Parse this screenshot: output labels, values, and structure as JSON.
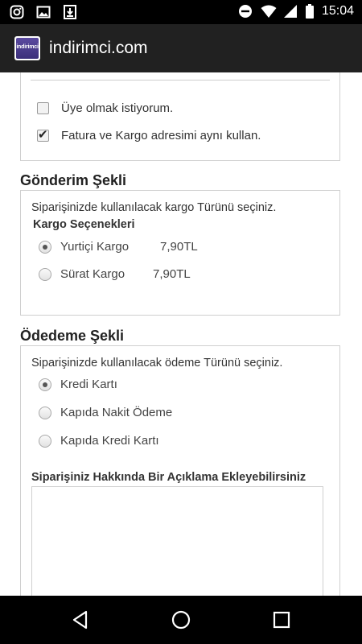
{
  "status_bar": {
    "left_icons": [
      "instagram-icon",
      "image-icon",
      "download-icon"
    ],
    "right_icons": [
      "do-not-disturb-icon",
      "wifi-icon",
      "signal-icon",
      "battery-icon"
    ],
    "time": "15:04"
  },
  "app_bar": {
    "logo_text": "indirimci",
    "title": "indirimci.com"
  },
  "account_options": {
    "items": [
      {
        "label": "Üye olmak istiyorum.",
        "checked": false
      },
      {
        "label": "Fatura ve Kargo adresimi aynı kullan.",
        "checked": true
      }
    ]
  },
  "shipping": {
    "title": "Gönderim Şekli",
    "hint": "Siparişinizde kullanılacak kargo Türünü seçiniz.",
    "subheading": "Kargo Seçenekleri",
    "options": [
      {
        "label": "Yurtiçi Kargo",
        "price": "7,90TL",
        "selected": true
      },
      {
        "label": "Sürat Kargo",
        "price": "7,90TL",
        "selected": false
      }
    ]
  },
  "payment": {
    "title": "Ödedeme Şekli",
    "hint": "Siparişinizde kullanılacak ödeme Türünü seçiniz.",
    "options": [
      {
        "label": "Kredi Kartı",
        "selected": true
      },
      {
        "label": "Kapıda Nakit Ödeme",
        "selected": false
      },
      {
        "label": "Kapıda Kredi Kartı",
        "selected": false
      }
    ],
    "note_label": "Siparişiniz Hakkında Bir Açıklama Ekleyebilirsiniz",
    "note_value": ""
  },
  "nav_bar": {
    "buttons": [
      "back-icon",
      "home-icon",
      "recents-icon"
    ]
  }
}
